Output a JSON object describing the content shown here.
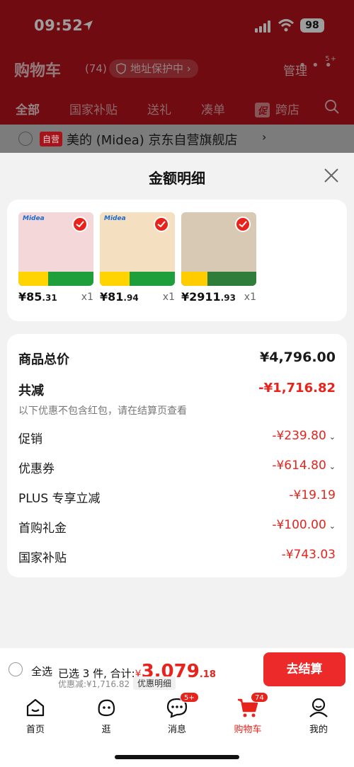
{
  "status_bar": {
    "time": "09:52",
    "battery": "98"
  },
  "cart_header": {
    "title": "购物车",
    "count": "(74)",
    "address_pill": "地址保护中",
    "address_chevron": "›",
    "manage": "管理",
    "more_badge": "5+"
  },
  "filter_tabs": [
    {
      "label": "全部",
      "active": true
    },
    {
      "label": "国家补贴",
      "active": false
    },
    {
      "label": "送礼",
      "active": false
    },
    {
      "label": "凑单",
      "active": false
    },
    {
      "label": "跨店",
      "active": false,
      "badge": "促"
    }
  ],
  "shop": {
    "tag": "自营",
    "name": "美的 (Midea) 京东自营旗舰店",
    "chevron": "›"
  },
  "sheet": {
    "title": "金额明细",
    "products": [
      {
        "price_int": "¥85",
        "price_dec": ".31",
        "qty": "x1",
        "img_color": "#f4d7d9",
        "checked": true
      },
      {
        "price_int": "¥81",
        "price_dec": ".94",
        "qty": "x1",
        "img_color": "#f4dfc0",
        "checked": true
      },
      {
        "price_int": "¥2911",
        "price_dec": ".93",
        "qty": "x1",
        "img_color": "#d8c9b4",
        "checked": true
      }
    ],
    "details": {
      "total_label": "商品总价",
      "total_value": "¥4,796.00",
      "reduce_label": "共减",
      "reduce_value": "-¥1,716.82",
      "note": "以下优惠不包含红包，请在结算页查看",
      "rows": [
        {
          "label": "促销",
          "value": "-¥239.80",
          "chevron": "⌄"
        },
        {
          "label": "优惠券",
          "value": "-¥614.80",
          "chevron": "⌄"
        },
        {
          "label": "PLUS 专享立减",
          "value": "-¥19.19",
          "chevron": ""
        },
        {
          "label": "首购礼金",
          "value": "-¥100.00",
          "chevron": "⌄"
        },
        {
          "label": "国家补贴",
          "value": "-¥743.03",
          "chevron": ""
        }
      ]
    }
  },
  "checkout": {
    "select_all": "全选",
    "summary_prefix": "已选 3 件, 合计:",
    "currency": "¥",
    "amount": "3,079",
    "amount_dec": ".18",
    "discount": "优惠减:¥1,716.82",
    "detail_link": "优惠明细",
    "button": "去结算"
  },
  "tabbar": [
    {
      "label": "首页",
      "icon": "home-icon",
      "active": false,
      "badge": ""
    },
    {
      "label": "逛",
      "icon": "browse-icon",
      "active": false,
      "badge": ""
    },
    {
      "label": "消息",
      "icon": "message-icon",
      "active": false,
      "badge": "5+"
    },
    {
      "label": "购物车",
      "icon": "cart-icon",
      "active": true,
      "badge": "74"
    },
    {
      "label": "我的",
      "icon": "profile-icon",
      "active": false,
      "badge": ""
    }
  ],
  "colors": {
    "brand_red": "#e8231c",
    "header_red": "#b5141c",
    "checkout_button": "#ec2a2a"
  }
}
